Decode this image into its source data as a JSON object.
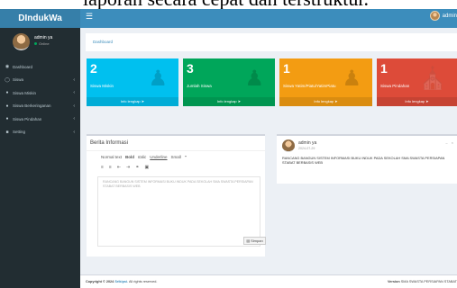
{
  "caption_fragment": "laporan secara cepat dan terstruktur.",
  "app": {
    "logo_text": "DIndukWa"
  },
  "navbar": {
    "toggle_icon": "hamburger-icon",
    "user_label": "admin"
  },
  "sidebar": {
    "user": {
      "name": "admin ya",
      "status": "Online"
    },
    "items": [
      {
        "label": "Dashboard",
        "icon": "dashboard-icon",
        "has_chevron": false
      },
      {
        "label": "Siswa",
        "icon": "users-icon",
        "has_chevron": true
      },
      {
        "label": "Siswa Miskin",
        "icon": "user-icon",
        "has_chevron": true
      },
      {
        "label": "Siswa Berkeringanan",
        "icon": "user-icon",
        "has_chevron": true
      },
      {
        "label": "Siswa Pindahan",
        "icon": "user-icon",
        "has_chevron": true
      },
      {
        "label": "Setting",
        "icon": "chart-icon",
        "has_chevron": true
      }
    ]
  },
  "breadcrumb": "Dashboard",
  "stats": [
    {
      "value": "2",
      "label": "Siswa Miskin",
      "footer": "Info lengkap",
      "icon": "user-icon"
    },
    {
      "value": "3",
      "label": "Jumlah Siswa",
      "footer": "Info lengkap",
      "icon": "user-icon"
    },
    {
      "value": "1",
      "label": "Siswa Yatim/Piatu/YatimPiatu",
      "footer": "Info lengkap",
      "icon": "user-icon"
    },
    {
      "value": "1",
      "label": "Siswa Pindahan",
      "footer": "Info lengkap",
      "icon": "bank-icon"
    }
  ],
  "berita": {
    "title": "Berita Informasi",
    "toolbar": [
      "Normal text",
      "Bold",
      "Italic",
      "Underline",
      "Small",
      "“"
    ],
    "toolbar_icons": [
      "list-ul-icon",
      "list-ol-icon",
      "outdent-icon",
      "indent-icon",
      "link-icon",
      "image-icon"
    ],
    "editor_text": "RANCANG BANGUN SISTEM INFORMASI BUKU INDUK PADA SEKOLAH SMA SWASTA PERSIAPAN STABAT BERBASIS WEB",
    "save_label": "Simpan"
  },
  "post": {
    "user": "admin ya",
    "date": "2024-07-29",
    "text": "RANCANG BANGUN SISTEM INFORMASI BUKU INDUK PADA SEKOLAH SMA SWASTA PERSIAPAN STABAT BERBASIS WEB"
  },
  "footer": {
    "copyright_prefix": "Copyright © 2024",
    "brand": "Srikipsi.",
    "rights": "All rights reserved.",
    "version_label": "Version",
    "version_text": "SMA SWASTA PERSIAPAN STABAT"
  },
  "colors": {
    "header": "#3c8dbc",
    "sidebar": "#222d32",
    "aqua": "#00c0ef",
    "green": "#00a65a",
    "yellow": "#f39c12",
    "red": "#dd4b39"
  }
}
